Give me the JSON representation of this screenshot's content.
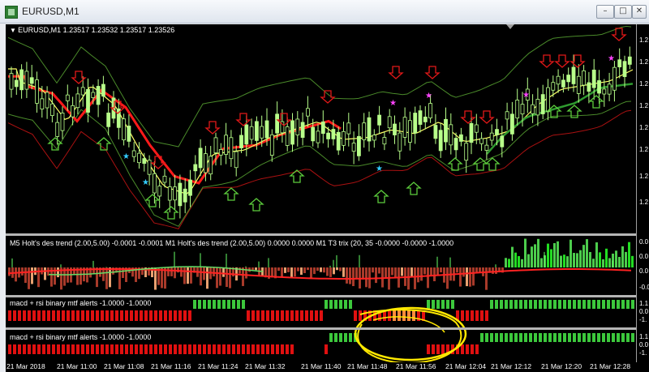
{
  "window": {
    "title": "EURUSD,M1"
  },
  "main": {
    "header": "EURUSD,M1  1.23517 1.23532 1.23517 1.23526"
  },
  "price_ticks": [
    "1.2",
    "1.2",
    "1.2",
    "1.2",
    "1.2",
    "1.2",
    "1.2",
    "1.2"
  ],
  "panels": [
    {
      "label": "M5 Holt's des trend (2.00,5.00) -0.0001 -0.0001  M1 Holt's des trend (2.00,5.00) 0.0000 0.0000  M1 T3 trix (20, 35 -0.0000 -0.0000 -1.0000",
      "scale": [
        "0.0",
        "0.0",
        "0.0",
        "-0.0"
      ]
    },
    {
      "label": "macd + rsi binary mtf alerts -1.0000 -1.0000",
      "scale": [
        "1.1",
        "0.0",
        "-1."
      ]
    },
    {
      "label": "macd + rsi binary mtf alerts -1.0000 -1.0000",
      "scale": [
        "1.1",
        "0.0",
        "-1."
      ]
    }
  ],
  "time_labels": [
    "21 Mar 2018",
    "21 Mar 11:00",
    "21 Mar 11:08",
    "21 Mar 11:16",
    "21 Mar 11:24",
    "21 Mar 11:32",
    "21 Mar 11:40",
    "21 Mar 11:48",
    "21 Mar 11:56",
    "21 Mar 12:04",
    "21 Mar 12:12",
    "21 Mar 12:20",
    "21 Mar 12:28"
  ],
  "colors": {
    "bg": "#000000",
    "bull": "#b8ff8a",
    "bear": "#000000",
    "ma_red": "#ff1a1a",
    "ma_yellow": "#ffff66",
    "band_green": "#4a8a2a",
    "band_red": "#aa1111",
    "arrow_up": "#5ccc3c",
    "arrow_down": "#e01818",
    "histo_red": "#a83a2a",
    "histo_green": "#4ccc4c",
    "alert_red": "#e01010",
    "alert_green": "#3cc83c",
    "highlight": "#ffe800"
  }
}
